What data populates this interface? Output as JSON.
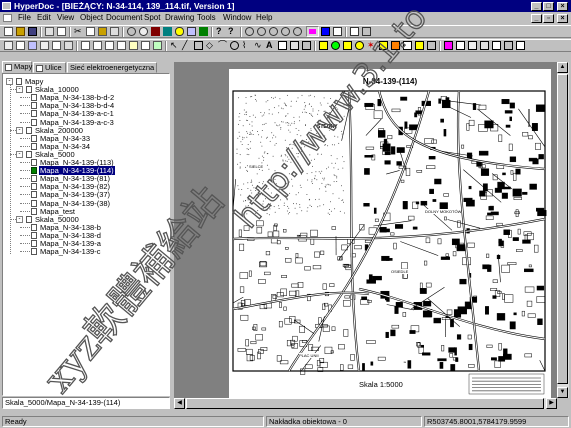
{
  "window": {
    "title": "HyperDoc - [BIEŻĄCY: N-34-114, 139_114.tif, Version 1]",
    "controls": {
      "minimize": "_",
      "maximize": "□",
      "close": "×"
    }
  },
  "menu": [
    "File",
    "Edit",
    "View",
    "Object",
    "Document",
    "Spot",
    "Drawing",
    "Tools",
    "Window",
    "Help"
  ],
  "left_panel": {
    "tabs": [
      "Mapy",
      "Ulice",
      "Sieć elektroenergetyczna"
    ],
    "tree": {
      "root": "Mapy",
      "groups": [
        {
          "label": "Skala_10000",
          "items": [
            "Mapa_N-34-138-b-d-2",
            "Mapa_N-34-138-b-d-4",
            "Mapa_N-34-139-a-c-1",
            "Mapa_N-34-139-a-c-3"
          ]
        },
        {
          "label": "Skala_200000",
          "items": [
            "Mapa_N-34-33",
            "Mapa_N-34-34"
          ]
        },
        {
          "label": "Skala_5000",
          "items": [
            "Mapa_N-34-139-(113)",
            "Mapa_N-34-139-(114)",
            "Mapa_N-34-139-(81)",
            "Mapa_N-34-139-(82)",
            "Mapa_N-34-139-(37)",
            "Mapa_N-34-139-(38)",
            "Mapa_test"
          ]
        },
        {
          "label": "Skala_50000",
          "items": [
            "Mapa_N-34-138-b",
            "Mapa_N-34-138-d",
            "Mapa_N-34-139-a",
            "Mapa_N-34-139-c"
          ]
        }
      ],
      "selected": "Mapa_N-34-139-(114)"
    },
    "path": "Skala_5000/Mapa_N-34-139-(114)"
  },
  "map": {
    "sheet_title": "N-34-139-(114)",
    "scale_label": "Skala  1:5000",
    "labels": [
      "STEGNY",
      "SIELCE",
      "OSIEDLE",
      "DOLNY MOKOTÓW",
      "PLAC UNII"
    ]
  },
  "statusbar": {
    "ready": "Ready",
    "overlay": "Nakładka obiektowa - 0",
    "coords": "R503745.8001,5784179.9599"
  },
  "watermark": {
    "vertical_text": "xyz軟體補給站",
    "url_text": "http://www.3.1.to"
  }
}
